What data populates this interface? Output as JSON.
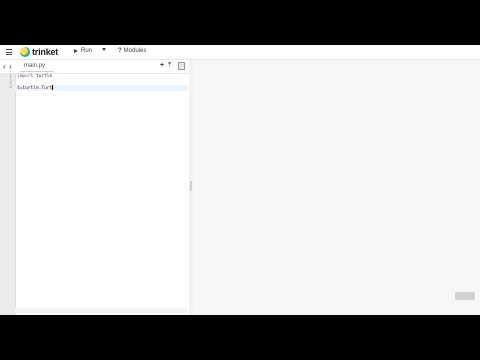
{
  "app": {
    "logo_text": "trinket",
    "colors": {
      "accent": "#2aa1d6",
      "logo_yellow": "#ffe14d"
    }
  },
  "toolbar": {
    "run_label": "Run",
    "modules_label": "Modules",
    "menu_icon": "hamburger-icon",
    "run_icon": "play-icon",
    "caret_icon": "chevron-down-icon"
  },
  "editor": {
    "tab_name": "main.py",
    "line_numbers": [
      "1",
      "2",
      "3"
    ],
    "lines": [
      {
        "keyword": "import",
        "rest": " turtle"
      },
      {
        "keyword": "",
        "rest": ""
      },
      {
        "keyword": "",
        "rest": "t=turtle.Turt"
      }
    ]
  },
  "output": {
    "button_label": ""
  }
}
